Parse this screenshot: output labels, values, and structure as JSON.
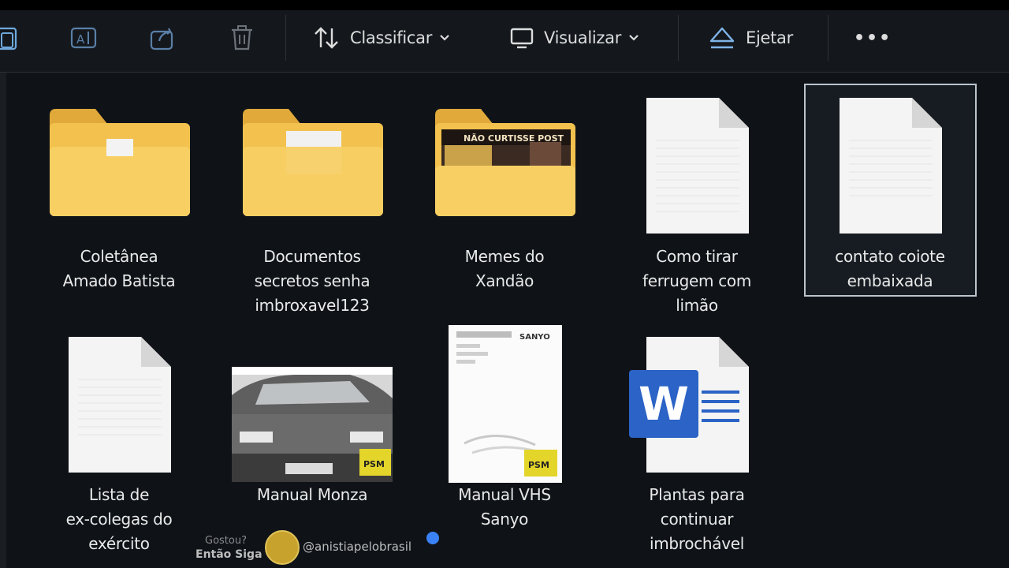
{
  "toolbar": {
    "sort_label": "Classificar",
    "view_label": "Visualizar",
    "eject_label": "Ejetar",
    "more_label": "•••"
  },
  "items": [
    {
      "name_lines": [
        "Coletânea",
        "Amado Batista"
      ],
      "type": "folder"
    },
    {
      "name_lines": [
        "Documentos",
        "secretos senha",
        "imbroxavel123"
      ],
      "type": "folder"
    },
    {
      "name_lines": [
        "Memes do",
        "Xandão"
      ],
      "type": "folder",
      "preview_text": "NÃO CURTISSE POST"
    },
    {
      "name_lines": [
        "Como tirar",
        "ferrugem com",
        "limão"
      ],
      "type": "text-file"
    },
    {
      "name_lines": [
        "contato coiote",
        "embaixada"
      ],
      "type": "text-file",
      "selected": true
    },
    {
      "name_lines": [
        "Lista de",
        "ex-colegas do",
        "exército"
      ],
      "type": "text-file"
    },
    {
      "name_lines": [
        "Manual Monza"
      ],
      "type": "pdf-image"
    },
    {
      "name_lines": [
        "Manual VHS",
        "Sanyo"
      ],
      "type": "pdf-document",
      "preview_brand": "SANYO"
    },
    {
      "name_lines": [
        "Plantas para",
        "continuar",
        "imbrochável"
      ],
      "type": "word-document",
      "icon_letter": "W"
    }
  ],
  "watermark": {
    "small_text": "Gostou?",
    "bold_text": "Então Siga",
    "handle": "@anistiapelobrasil"
  },
  "colors": {
    "background": "#0f1318",
    "folder": "#f2c14e",
    "word_blue": "#2b63c6",
    "selection_border": "#bcc4cc"
  }
}
